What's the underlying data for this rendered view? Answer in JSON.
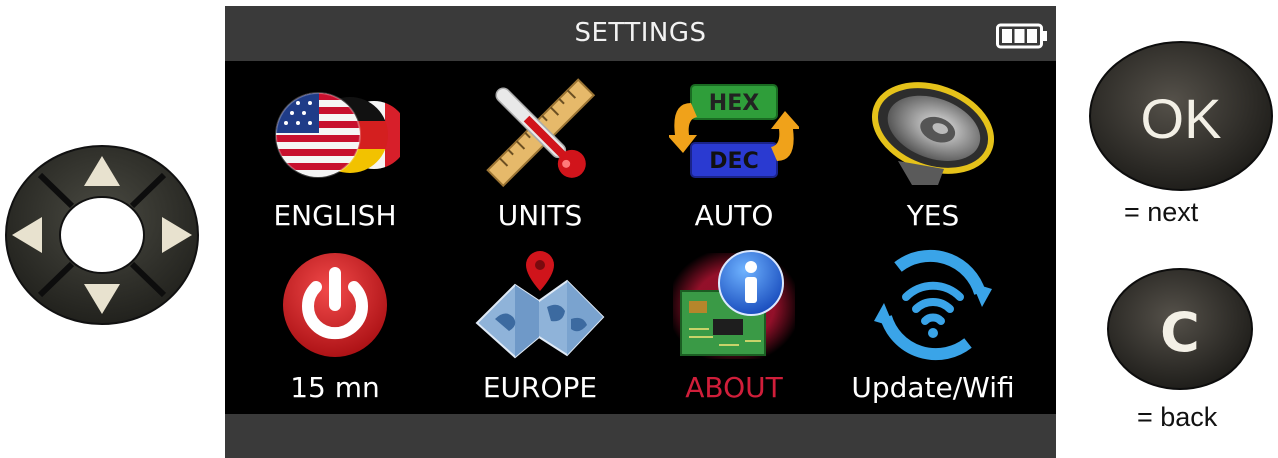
{
  "screen": {
    "title": "SETTINGS",
    "battery_icon": "battery-full-icon",
    "tiles": [
      {
        "label": "ENGLISH",
        "icon": "language-flags-icon",
        "selected": false
      },
      {
        "label": "UNITS",
        "icon": "units-ruler-thermometer-icon",
        "selected": false
      },
      {
        "label": "AUTO",
        "icon": "hex-dec-conversion-icon",
        "selected": false,
        "icon_text_top": "HEX",
        "icon_text_bottom": "DEC"
      },
      {
        "label": "YES",
        "icon": "speaker-sound-icon",
        "selected": false
      },
      {
        "label": "15 mn",
        "icon": "power-off-timer-icon",
        "selected": false
      },
      {
        "label": "EUROPE",
        "icon": "region-map-pin-icon",
        "selected": false
      },
      {
        "label": "ABOUT",
        "icon": "about-info-icon",
        "selected": true
      },
      {
        "label": "Update/Wifi",
        "icon": "wifi-update-icon",
        "selected": false
      }
    ]
  },
  "controls": {
    "dpad_icon": "dpad-arrows-icon",
    "ok_button": {
      "label": "OK",
      "caption": "= next"
    },
    "c_button": {
      "label": "C",
      "caption": "= back"
    }
  },
  "colors": {
    "screen_bg": "#000000",
    "bar_bg": "#3a3a3a",
    "selected_label": "#d01e3a",
    "label": "#ffffff"
  }
}
